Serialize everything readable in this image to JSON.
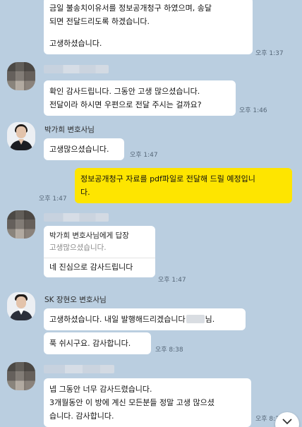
{
  "messages": {
    "m1": {
      "lines": [
        "금일 불송치이유서를 정보공개청구 하였으며, 송달",
        "되면 전달드리도록 하겠습니다.",
        "고생하셨습니다."
      ],
      "time": "오후 1:37"
    },
    "m2": {
      "lines": [
        "확인 감사드립니다. 그동안 고생 많으셨습니다.",
        "전달이라 하시면 우편으로 전달 주시는 걸까요?"
      ],
      "time": "오후 1:46"
    },
    "m3": {
      "sender": "박가희 변호사님",
      "text": "고생많으셨습니다.",
      "time": "오후 1:47"
    },
    "m4": {
      "lines": [
        "정보공개청구 자료를 pdf파일로 전달해 드릴 예정입니",
        "다."
      ],
      "time": "오후 1:47"
    },
    "m5": {
      "reply_to": "박가희 변호사님에게 답장",
      "reply_quote": "고생많으셨습니다.",
      "text": "네 진심으로 감사드립니다",
      "time": "오후 1:47"
    },
    "m6": {
      "sender": "SK 장현오 변호사님",
      "text_before": "고생하셨습니다. 내일 발행해드리겠습니다",
      "text_after": "님."
    },
    "m7": {
      "text": "푹 쉬시구요. 감사합니다.",
      "time": "오후 8:38"
    },
    "m8": {
      "lines": [
        "넵 그동안 너무 감사드렸습니다.",
        "3개월동안 이 방에 계신 모든분들 정말 고생 많으셨",
        "습니다. 감사합니다."
      ],
      "time": "오후 8:39"
    }
  },
  "icons": {
    "scroll_down": "chevron-down-icon"
  },
  "colors": {
    "background": "#bacee0",
    "bubble_other": "#ffffff",
    "bubble_mine": "#fee500"
  }
}
